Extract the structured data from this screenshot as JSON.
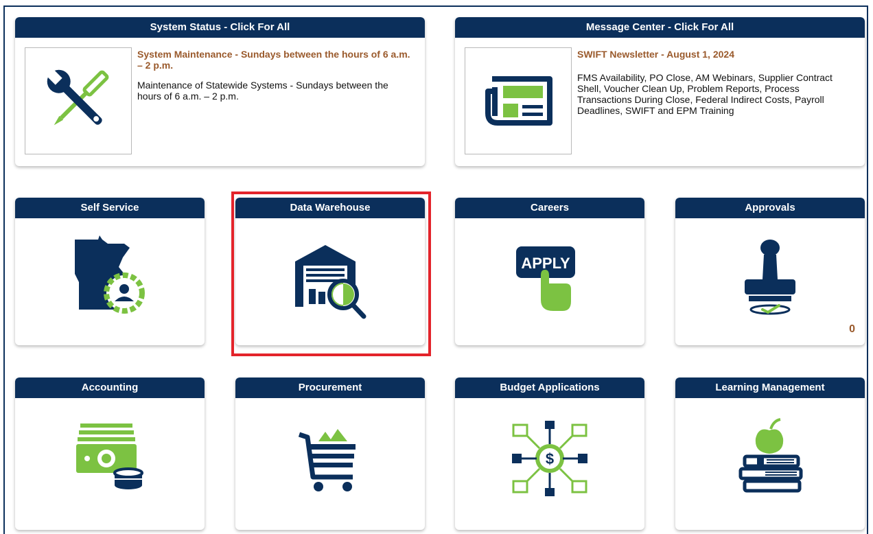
{
  "colors": {
    "navy": "#0b2f5b",
    "green": "#7cc242",
    "title_brown": "#9a5a2c",
    "highlight_red": "#e3242b"
  },
  "system_status": {
    "header": "System Status - Click For All",
    "title": "System Maintenance - Sundays between the hours of 6 a.m. – 2 p.m.",
    "text": "Maintenance of Statewide Systems - Sundays between the hours of 6 a.m. – 2 p.m.",
    "icon": "tools-icon"
  },
  "message_center": {
    "header": "Message Center - Click For All",
    "title": "SWIFT Newsletter - August 1, 2024",
    "text": "FMS Availability, PO Close, AM Webinars, Supplier Contract Shell, Voucher Clean Up, Problem Reports, Process Transactions During Close, Federal Indirect Costs, Payroll Deadlines, SWIFT and EPM Training",
    "icon": "newspaper-icon"
  },
  "tiles": [
    {
      "label": "Self Service",
      "icon": "minnesota-gear-person-icon"
    },
    {
      "label": "Data Warehouse",
      "icon": "warehouse-search-icon"
    },
    {
      "label": "Careers",
      "icon": "apply-hand-icon",
      "icon_text": "APPLY"
    },
    {
      "label": "Approvals",
      "icon": "stamp-icon",
      "badge": "0"
    },
    {
      "label": "Accounting",
      "icon": "money-coins-icon"
    },
    {
      "label": "Procurement",
      "icon": "shopping-cart-icon"
    },
    {
      "label": "Budget Applications",
      "icon": "budget-network-icon"
    },
    {
      "label": "Learning Management",
      "icon": "apple-books-icon"
    }
  ]
}
